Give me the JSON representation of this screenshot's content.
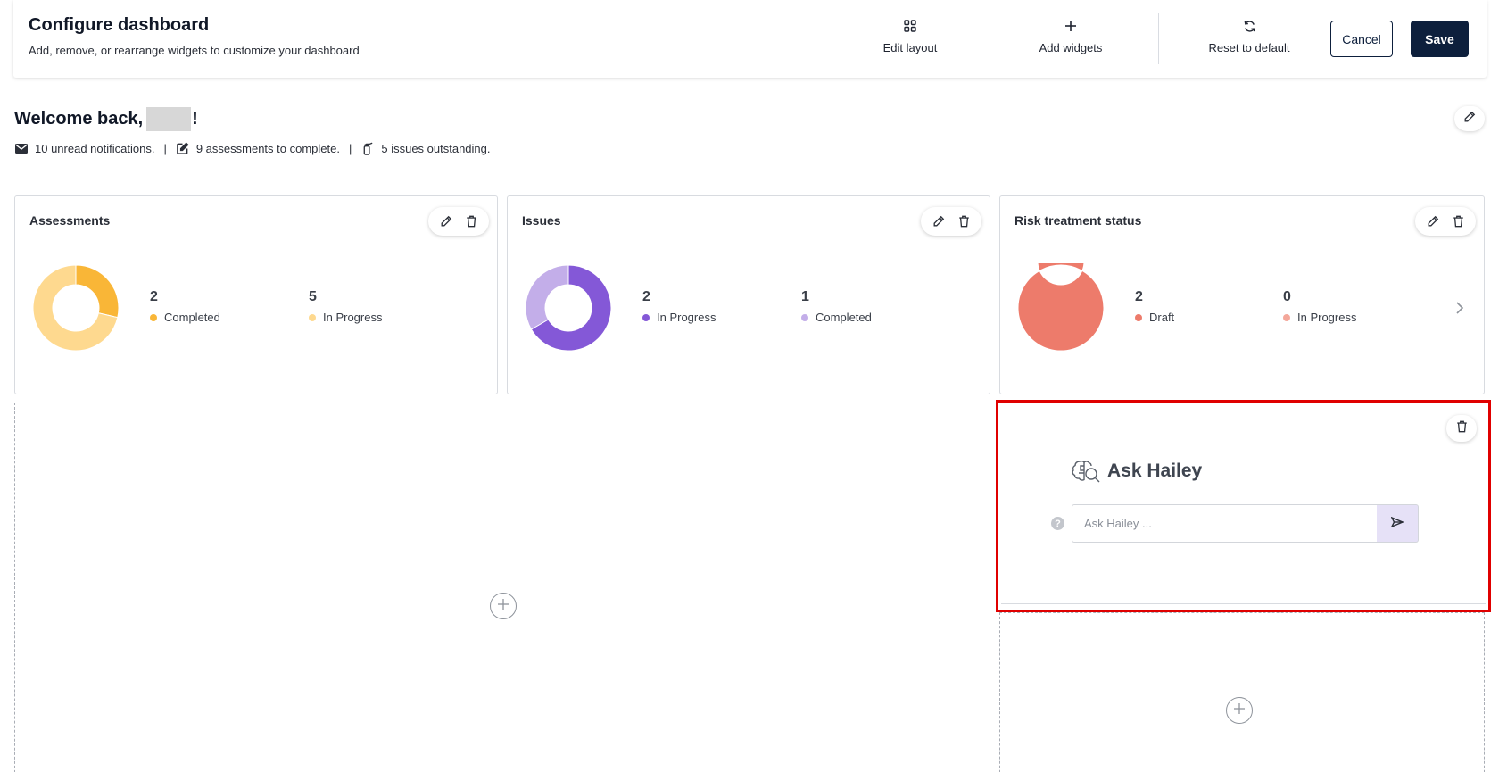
{
  "header": {
    "title": "Configure dashboard",
    "subtitle": "Add, remove, or rearrange widgets to customize your dashboard",
    "actions": {
      "edit_layout": "Edit layout",
      "add_widgets": "Add widgets",
      "reset_default": "Reset to default"
    },
    "cancel_label": "Cancel",
    "save_label": "Save"
  },
  "welcome": {
    "greeting": "Welcome back,",
    "suffix": "!",
    "stats": [
      {
        "text": "10 unread notifications.",
        "icon": "envelope-icon"
      },
      {
        "text": "9 assessments to complete.",
        "icon": "edit-square-icon"
      },
      {
        "text": "5 issues outstanding.",
        "icon": "fire-extinguisher-icon"
      }
    ],
    "separator": "|"
  },
  "widgets": [
    {
      "title": "Assessments",
      "metrics": [
        {
          "value": "2",
          "label": "Completed",
          "color": "#f9b637"
        },
        {
          "value": "5",
          "label": "In Progress",
          "color": "#fed98f"
        }
      ],
      "donut": [
        2,
        5
      ]
    },
    {
      "title": "Issues",
      "metrics": [
        {
          "value": "2",
          "label": "In Progress",
          "color": "#8458d7"
        },
        {
          "value": "1",
          "label": "Completed",
          "color": "#c3aee9"
        }
      ],
      "donut": [
        2,
        1
      ]
    },
    {
      "title": "Risk treatment status",
      "metrics": [
        {
          "value": "2",
          "label": "Draft",
          "color": "#ed7b6b"
        },
        {
          "value": "0",
          "label": "In Progress",
          "color": "#f4a79a"
        }
      ],
      "donut": [
        2,
        0
      ]
    }
  ],
  "hailey": {
    "title": "Ask Hailey",
    "placeholder": "Ask Hailey ...",
    "help": "?"
  }
}
